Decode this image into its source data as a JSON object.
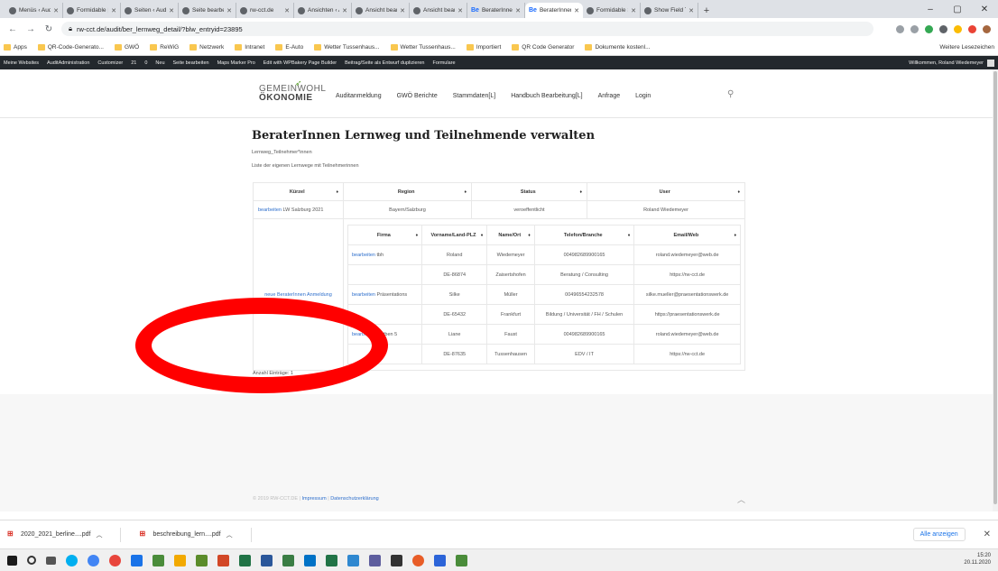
{
  "browser": {
    "tabs": [
      {
        "label": "Menüs ‹ Audit",
        "fav": "globe"
      },
      {
        "label": "Formidable | F",
        "fav": "globe"
      },
      {
        "label": "Seiten ‹ Audit",
        "fav": "globe"
      },
      {
        "label": "Seite bearbei",
        "fav": "globe"
      },
      {
        "label": "rw-cct.de",
        "fav": "globe"
      },
      {
        "label": "Ansichten ‹ A",
        "fav": "globe"
      },
      {
        "label": "Ansicht bearb",
        "fav": "globe"
      },
      {
        "label": "Ansicht bearb",
        "fav": "globe"
      },
      {
        "label": "BeraterInnen",
        "fav": "Be"
      },
      {
        "label": "BeraterInnen",
        "fav": "Be",
        "active": true
      },
      {
        "label": "Formidable S",
        "fav": "globe"
      },
      {
        "label": "Show Field T",
        "fav": "globe"
      }
    ],
    "new_tab": "+",
    "window_controls": [
      "–",
      "▢",
      "✕"
    ],
    "url": "rw-cct.de/audit/ber_lernweg_detail/?blw_entryid=23895",
    "bookmarks": [
      "Apps",
      "QR-Code-Generato...",
      "GWÖ",
      "ReWiG",
      "Netzwerk",
      "Intranet",
      "E-Auto",
      "Wetter Tussenhaus...",
      "Wetter Tussenhaus...",
      "Importiert",
      "QR Code Generator",
      "Dokumente kostenl..."
    ],
    "bookmarks_right": "Weitere Lesezeichen",
    "wp_admin_bar": [
      "Meine Websites",
      "AuditAdministration",
      "Customizer",
      "21",
      "0",
      "Neu",
      "Seite bearbeiten",
      "Maps Marker Pro",
      "Edit with WPBakery Page Builder",
      "Beitrag/Seite als Entwurf duplizieren",
      "Formulare"
    ],
    "wp_welcome": "Willkommen, Roland Wiedemeyer"
  },
  "site": {
    "logo_line1": "GEMEINWOHL",
    "logo_line2": "ÖKONOMIE",
    "nav": [
      "Auditanmeldung",
      "GWÖ Berichte",
      "Stammdaten[L]",
      "Handbuch Bearbeitung[L]",
      "Anfrage",
      "Login"
    ],
    "title": "BeraterInnen Lernweg und Teilnehmende verwalten",
    "sub1": "Lernweg_Teilnehmer*innen",
    "sub2": "Liste der eigenen Lernwege mit Teilnehmerinnen",
    "outer_headers": [
      "Kürzel",
      "Region",
      "Status",
      "User"
    ],
    "outer_row": {
      "link": "bearbeiten",
      "kuerzel": "LW Salzburg 2021",
      "region": "Bayern/Salzburg",
      "status": "veroeffentlicht",
      "user": "Roland Wiedemeyer"
    },
    "left_link": "neue BeraterInnen Anmeldung",
    "inner_headers": [
      "Firma",
      "Vorname/Land-PLZ",
      "Name/Ort",
      "Telefon/Branche",
      "Email/Web"
    ],
    "inner_rows": [
      {
        "link": "bearbeiten",
        "firma": "tbh",
        "c1": "Roland",
        "c2": "Wiedemeyer",
        "c3": "004982689900165",
        "c4": "roland.wiedemeyer@web.de"
      },
      {
        "link": "",
        "firma": "",
        "c1": "DE-86874",
        "c2": "Zaisertshofen",
        "c3": "Beratung / Consulting",
        "c4": "https://rw-cct.de"
      },
      {
        "link": "bearbeiten",
        "firma": "Präsentations",
        "c1": "Silke",
        "c2": "Müller",
        "c3": "00496554232578",
        "c4": "silke.mueller@praesentationswerk.de"
      },
      {
        "link": "",
        "firma": "",
        "c1": "DE-65432",
        "c2": "Frankfurt",
        "c3": "Bildung / Universität / FH / Schulen",
        "c4": "https://praesentationswerk.de"
      },
      {
        "link": "bearbeiten",
        "firma": "testben 5",
        "c1": "Liane",
        "c2": "Faust",
        "c3": "004982689900165",
        "c4": "roland.wiedemeyer@web.de"
      },
      {
        "link": "",
        "firma": "",
        "c1": "DE-87635",
        "c2": "Tussenhausen",
        "c3": "EDV / IT",
        "c4": "https://rw-cct.de"
      }
    ],
    "count": "Anzahl Einträge: 1",
    "footer_prefix": "© 2019 RW-CCT.DE |",
    "footer_impressum": "Impressum",
    "footer_sep": "|",
    "footer_datenschutz": "Datenschutzerklärung"
  },
  "downloads": {
    "items": [
      "2020_2021_berline....pdf",
      "beschreibung_lern....pdf"
    ],
    "show_all": "Alle anzeigen"
  },
  "taskbar": {
    "time": "15:20",
    "date": "20.11.2020"
  },
  "colors": {
    "annotation": "#ff0000",
    "link": "#2e6fcc"
  }
}
